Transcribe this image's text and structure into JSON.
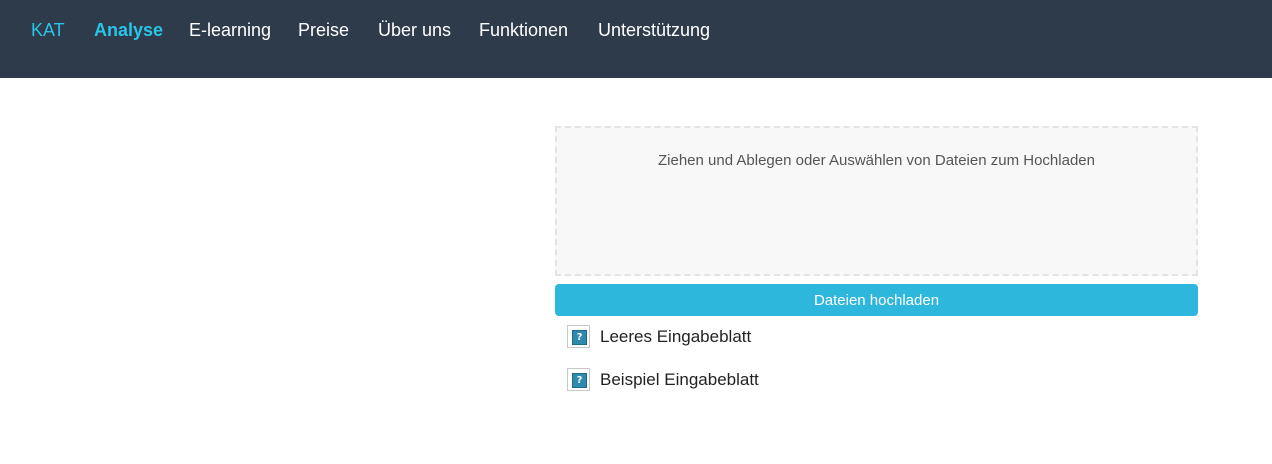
{
  "nav": {
    "brand": "KAT",
    "items": [
      {
        "label": "Analyse",
        "active": true
      },
      {
        "label": "E-learning"
      },
      {
        "label": "Preise"
      },
      {
        "label": "Über uns"
      },
      {
        "label": "Funktionen"
      },
      {
        "label": "Unterstützung"
      }
    ]
  },
  "upload": {
    "dropzone_text": "Ziehen und Ablegen oder Auswählen von Dateien zum Hochladen",
    "button_label": "Dateien hochladen"
  },
  "files": [
    {
      "label": "Leeres Eingabeblatt",
      "icon": "broken-image-icon"
    },
    {
      "label": "Beispiel Eingabeblatt",
      "icon": "broken-image-icon"
    }
  ],
  "colors": {
    "navbar_bg": "#2e3b4b",
    "accent": "#29c4e8",
    "button_bg": "#2eb7dd"
  }
}
